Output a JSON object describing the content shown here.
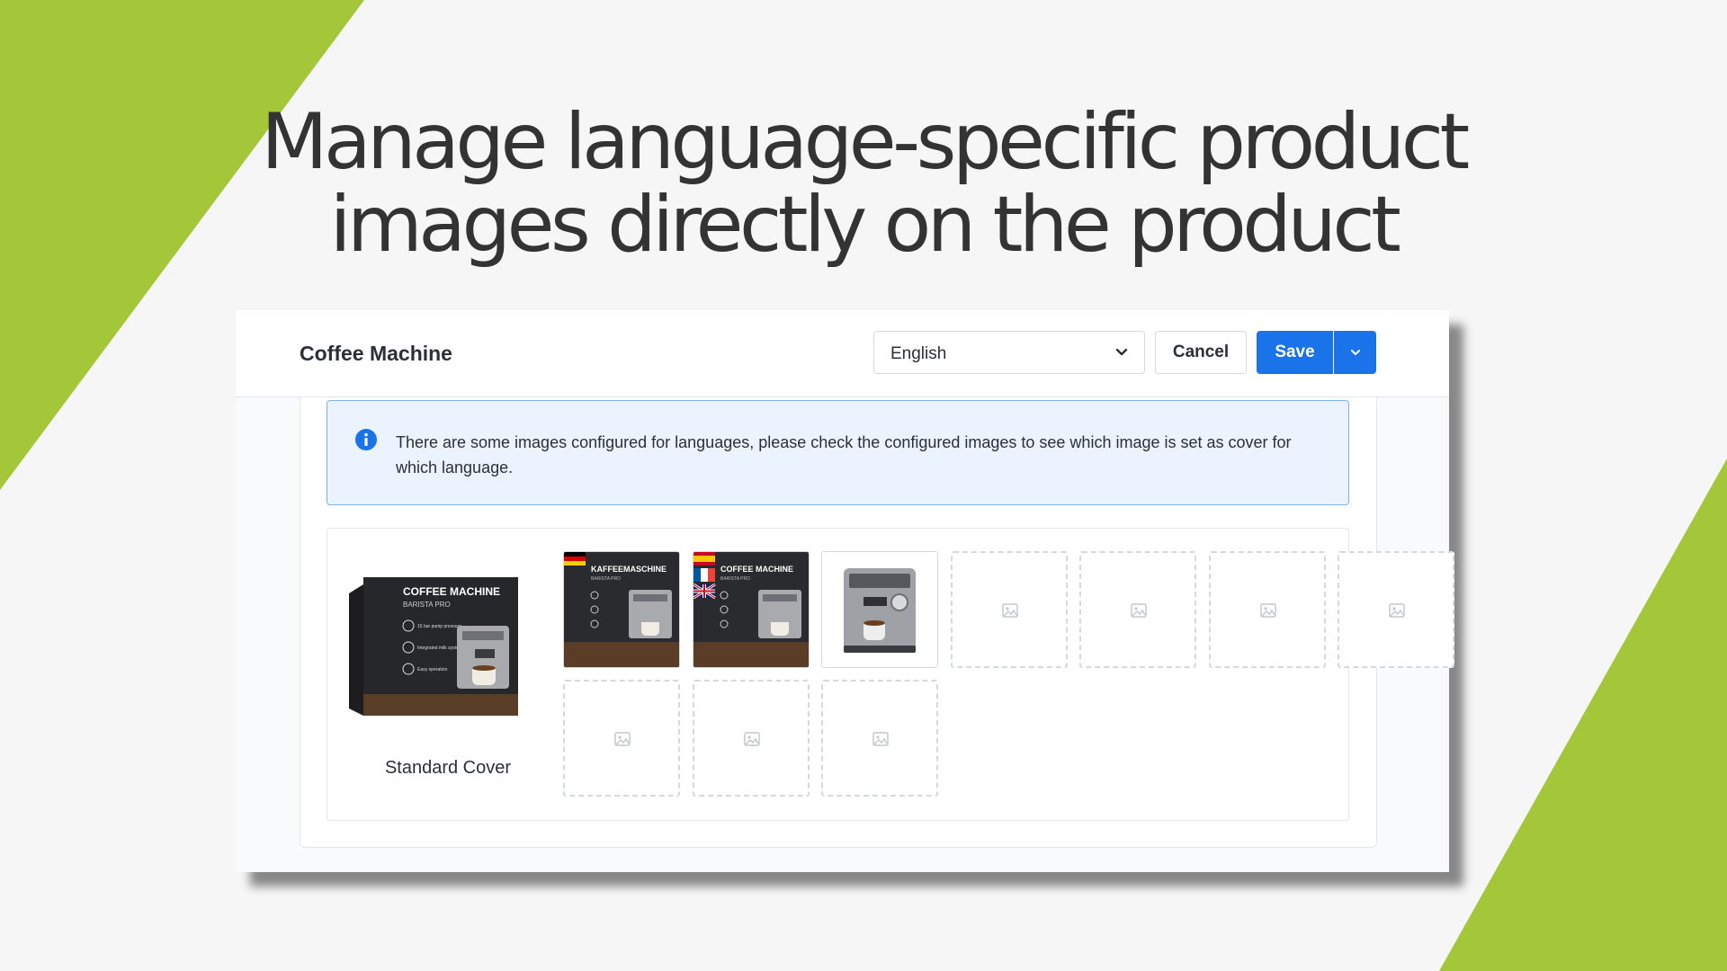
{
  "slide": {
    "headline_line1": "Manage language-specific product",
    "headline_line2": "images directly on the product",
    "accent_color": "#a4c639",
    "background_color": "#f6f6f6"
  },
  "header": {
    "product_name": "Coffee Machine",
    "language_select": {
      "value": "English"
    },
    "cancel_label": "Cancel",
    "save_label": "Save",
    "primary_color": "#1a73e8"
  },
  "alert": {
    "icon": "info-icon",
    "message": "There are some images configured for languages, please check the configured images to see which image is set as cover for which language."
  },
  "media": {
    "cover": {
      "label": "Standard Cover",
      "box_title": "COFFEE MACHINE",
      "box_subtitle": "BARISTA PRO",
      "features": [
        "15 bar pump pressure",
        "Integrated milk system",
        "Easy operation"
      ]
    },
    "thumbnails": [
      {
        "type": "box",
        "box_title": "KAFFEEMASCHINE",
        "box_subtitle": "BARISTA PRO",
        "flags": [
          "Germany"
        ]
      },
      {
        "type": "box",
        "box_title": "COFFEE MACHINE",
        "box_subtitle": "BARISTA PRO",
        "flags": [
          "Spain",
          "France",
          "United Kingdom"
        ]
      },
      {
        "type": "photo",
        "flags": []
      },
      {
        "type": "empty"
      },
      {
        "type": "empty"
      },
      {
        "type": "empty"
      },
      {
        "type": "empty"
      },
      {
        "type": "empty"
      },
      {
        "type": "empty"
      },
      {
        "type": "empty"
      }
    ]
  }
}
